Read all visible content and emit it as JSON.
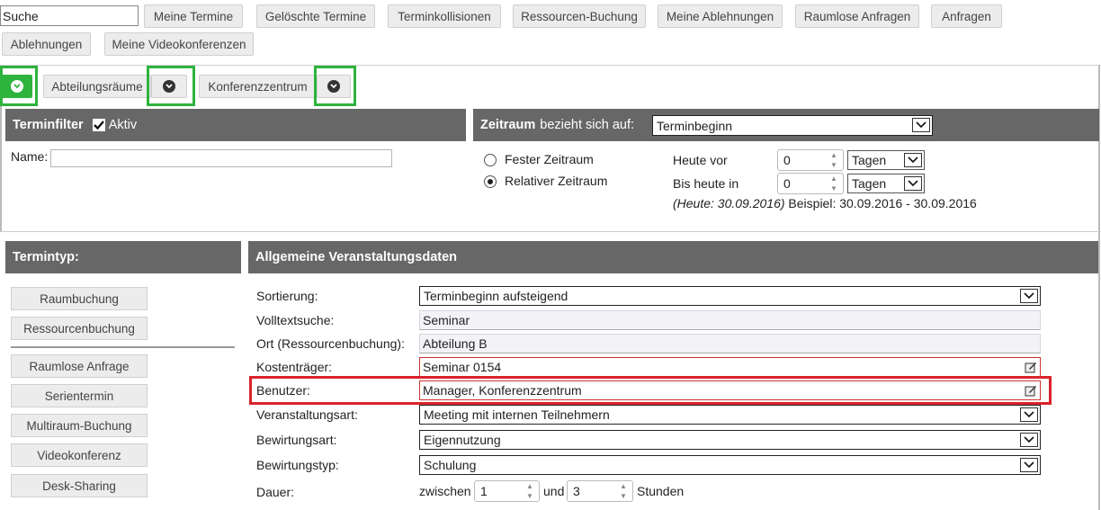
{
  "top": {
    "search_value": "Suche",
    "buttons": [
      "Meine Termine",
      "Gelöschte Termine",
      "Terminkollisionen",
      "Ressourcen-Buchung",
      "Meine Ablehnungen",
      "Raumlose Anfragen",
      "Anfragen",
      "Ablehnungen",
      "Meine Videokonferenzen"
    ]
  },
  "tabs": {
    "labels": [
      "Abteilungsräume",
      "Konferenzzentrum"
    ]
  },
  "terminfilter": {
    "title": "Terminfilter",
    "aktiv_label": "Aktiv",
    "aktiv_checked": true,
    "name_label": "Name:",
    "name_value": ""
  },
  "zeitraum": {
    "title_bold": "Zeitraum",
    "title_rest": "bezieht sich auf:",
    "select_value": "Terminbeginn",
    "radio_fixed": "Fester Zeitraum",
    "radio_relative": "Relativer Zeitraum",
    "selected": "relative",
    "heute_vor_label": "Heute vor",
    "heute_vor_value": "0",
    "heute_vor_unit": "Tagen",
    "bis_heute_label": "Bis heute in",
    "bis_heute_value": "0",
    "bis_heute_unit": "Tagen",
    "note_italic": "(Heute: 30.09.2016)",
    "note_rest": " Beispiel: 30.09.2016 - 30.09.2016"
  },
  "termintyp": {
    "title": "Termintyp:",
    "group1": [
      "Raumbuchung",
      "Ressourcenbuchung"
    ],
    "group2": [
      "Raumlose Anfrage",
      "Serientermin",
      "Multiraum-Buchung",
      "Videokonferenz",
      "Desk-Sharing"
    ]
  },
  "allgemein": {
    "title": "Allgemeine Veranstaltungsdaten",
    "sortierung_label": "Sortierung:",
    "sortierung_value": "Terminbeginn aufsteigend",
    "volltext_label": "Volltextsuche:",
    "volltext_value": "Seminar",
    "ort_label": "Ort (Ressourcenbuchung):",
    "ort_value": "Abteilung B",
    "kosten_label": "Kostenträger:",
    "kosten_value": "Seminar 0154",
    "benutzer_label": "Benutzer:",
    "benutzer_value": "Manager, Konferenzzentrum",
    "art_label": "Veranstaltungsart:",
    "art_value": "Meeting mit internen Teilnehmern",
    "bewirtungsart_label": "Bewirtungsart:",
    "bewirtungsart_value": "Eigennutzung",
    "bewirtungstyp_label": "Bewirtungstyp:",
    "bewirtungstyp_value": "Schulung",
    "dauer_label": "Dauer:",
    "zwischen": "zwischen",
    "dauer_from": "1",
    "und": "und",
    "dauer_to": "3",
    "stunden": "Stunden"
  },
  "colors": {
    "header_bg": "#676767",
    "highlight_green": "#2eb33e",
    "highlight_red": "#d9232b"
  }
}
